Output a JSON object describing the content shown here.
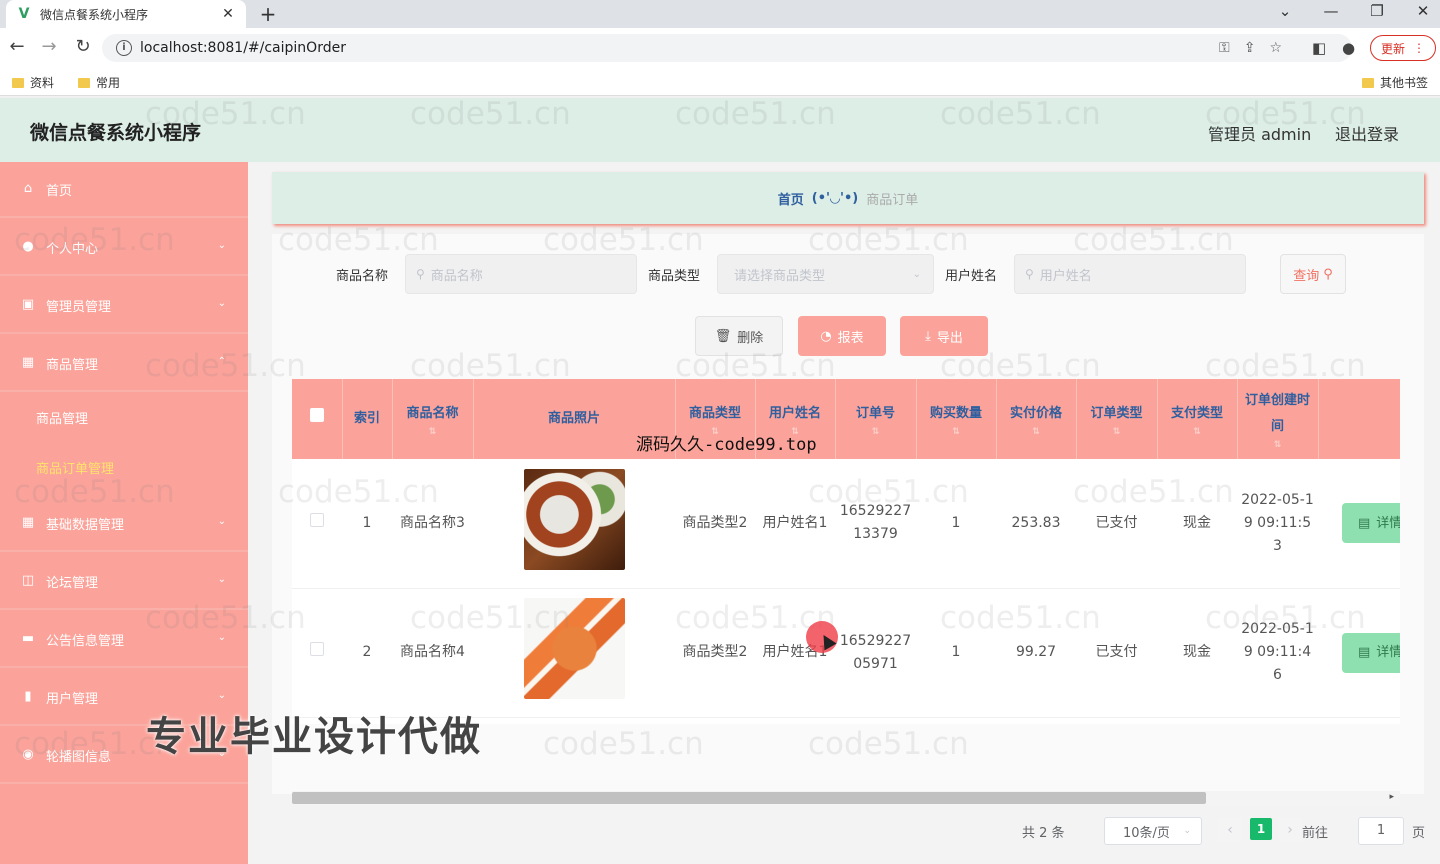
{
  "browser": {
    "tab_title": "微信点餐系统小程序",
    "tab_close": "✕",
    "new_tab": "+",
    "url": "localhost:8081/#/caipinOrder",
    "update_label": "更新",
    "bookmarks": [
      "资料",
      "常用"
    ],
    "other_bookmarks": "其他书签"
  },
  "header": {
    "app_title": "微信点餐系统小程序",
    "user_label": "管理员 admin",
    "logout_label": "退出登录"
  },
  "sidebar": {
    "items": [
      {
        "label": "首页",
        "icon": "home-icon"
      },
      {
        "label": "个人中心",
        "icon": "user-icon"
      },
      {
        "label": "管理员管理",
        "icon": "admin-icon"
      },
      {
        "label": "商品管理",
        "icon": "goods-icon"
      },
      {
        "label": "商品管理",
        "icon": ""
      },
      {
        "label": "商品订单管理",
        "icon": ""
      },
      {
        "label": "基础数据管理",
        "icon": "grid-icon"
      },
      {
        "label": "论坛管理",
        "icon": "forum-icon"
      },
      {
        "label": "公告信息管理",
        "icon": "notice-icon"
      },
      {
        "label": "用户管理",
        "icon": "users-icon"
      },
      {
        "label": "轮播图信息",
        "icon": "carousel-icon"
      }
    ]
  },
  "breadcrumb": {
    "home": "首页",
    "separator": "(•'◡'•)",
    "current": "商品订单"
  },
  "search": {
    "name_label": "商品名称",
    "name_placeholder": "商品名称",
    "type_label": "商品类型",
    "type_placeholder": "请选择商品类型",
    "user_label": "用户姓名",
    "user_placeholder": "用户姓名",
    "query_label": "查询"
  },
  "actions": {
    "delete": "删除",
    "report": "报表",
    "export": "导出"
  },
  "table": {
    "columns": [
      "索引",
      "商品名称",
      "商品照片",
      "商品类型",
      "用户姓名",
      "订单号",
      "购买数量",
      "实付价格",
      "订单类型",
      "支付类型",
      "订单创建时间"
    ],
    "rows": [
      {
        "index": "1",
        "goods_name": "商品名称3",
        "photo": "food-photo-crab",
        "goods_type": "商品类型2",
        "user_name": "用户姓名1",
        "order_no": "1652922713379",
        "quantity": "1",
        "price": "253.83",
        "order_type": "已支付",
        "pay_type": "现金",
        "created": "2022-05-19 09:11:53",
        "detail": "详情"
      },
      {
        "index": "2",
        "goods_name": "商品名称4",
        "photo": "food-photo-sushi",
        "goods_type": "商品类型2",
        "user_name": "用户姓名1",
        "order_no": "1652922705971",
        "quantity": "1",
        "price": "99.27",
        "order_type": "已支付",
        "pay_type": "现金",
        "created": "2022-05-19 09:11:46",
        "detail": "详情"
      }
    ]
  },
  "pagination": {
    "total": "共 2 条",
    "page_size": "10条/页",
    "current_page": "1",
    "goto_label": "前往",
    "goto_value": "1",
    "page_unit": "页"
  },
  "overlays": {
    "source_text": "源码久久-code99.top",
    "promo_text": "专业毕业设计代做",
    "watermark": "code51.cn"
  },
  "colors": {
    "sidebar_bg": "#fba39a",
    "header_bg": "#dceee6",
    "accent_green": "#19b96b",
    "detail_btn": "#8fe0b0"
  }
}
